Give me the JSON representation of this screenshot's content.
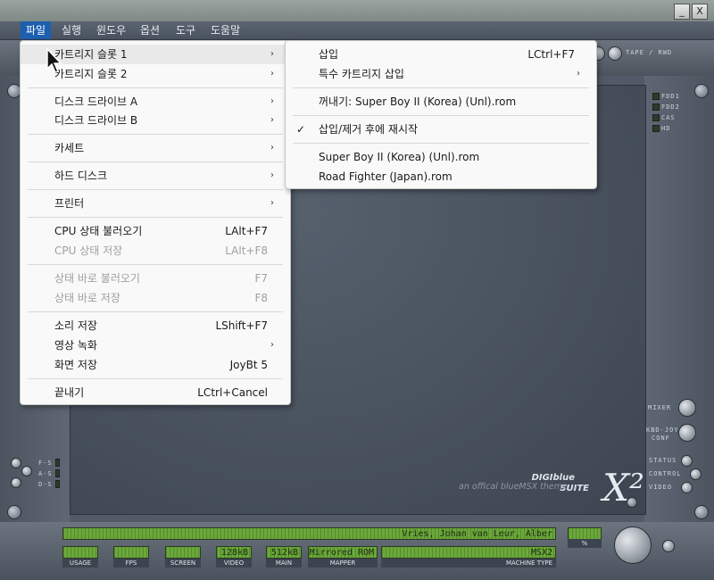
{
  "window": {
    "minimize_label": "_",
    "close_label": "X"
  },
  "menubar": {
    "items": [
      "파일",
      "실행",
      "윈도우",
      "옵션",
      "도구",
      "도움말"
    ]
  },
  "toolbar": {
    "tape_label": "TAPE / RWD"
  },
  "file_menu": {
    "items": [
      {
        "label": "카트리지 슬롯 1",
        "shortcut": "",
        "submenu": true,
        "enabled": true
      },
      {
        "label": "카트리지 슬롯 2",
        "shortcut": "",
        "submenu": true,
        "enabled": true
      },
      {
        "label": "디스크 드라이브 A",
        "shortcut": "",
        "submenu": true,
        "enabled": true
      },
      {
        "label": "디스크 드라이브 B",
        "shortcut": "",
        "submenu": true,
        "enabled": true
      },
      {
        "label": "카세트",
        "shortcut": "",
        "submenu": true,
        "enabled": true
      },
      {
        "label": "하드 디스크",
        "shortcut": "",
        "submenu": true,
        "enabled": true
      },
      {
        "label": "프린터",
        "shortcut": "",
        "submenu": true,
        "enabled": true
      },
      {
        "label": "CPU 상태 불러오기",
        "shortcut": "LAlt+F7",
        "submenu": false,
        "enabled": true
      },
      {
        "label": "CPU 상태 저장",
        "shortcut": "LAlt+F8",
        "submenu": false,
        "enabled": false
      },
      {
        "label": "상태 바로 불러오기",
        "shortcut": "F7",
        "submenu": false,
        "enabled": false
      },
      {
        "label": "상태 바로 저장",
        "shortcut": "F8",
        "submenu": false,
        "enabled": false
      },
      {
        "label": "소리 저장",
        "shortcut": "LShift+F7",
        "submenu": false,
        "enabled": true
      },
      {
        "label": "영상 녹화",
        "shortcut": "",
        "submenu": true,
        "enabled": true
      },
      {
        "label": "화면 저장",
        "shortcut": "JoyBt 5",
        "submenu": false,
        "enabled": true
      },
      {
        "label": "끝내기",
        "shortcut": "LCtrl+Cancel",
        "submenu": false,
        "enabled": true
      }
    ]
  },
  "cartridge_menu": {
    "items": [
      {
        "label": "삽입",
        "shortcut": "LCtrl+F7",
        "submenu": false,
        "checked": false
      },
      {
        "label": "특수 카트리지 삽입",
        "shortcut": "",
        "submenu": true,
        "checked": false
      },
      {
        "label": "꺼내기: Super Boy II (Korea) (Unl).rom",
        "shortcut": "",
        "submenu": false,
        "checked": false
      },
      {
        "label": "삽입/제거 후에 재시작",
        "shortcut": "",
        "submenu": false,
        "checked": true
      },
      {
        "label": "Super Boy II (Korea) (Unl).rom",
        "shortcut": "",
        "submenu": false,
        "checked": false
      },
      {
        "label": "Road Fighter (Japan).rom",
        "shortcut": "",
        "submenu": false,
        "checked": false
      }
    ],
    "check_mark": "✓"
  },
  "leds_right": [
    "FDD1",
    "FDD2",
    "CAS",
    "HD"
  ],
  "leds_left": [
    "F-S",
    "A-S",
    "D-S"
  ],
  "controls_right": {
    "mixer": "MIXER",
    "kbd_joy": "KBD-JOY",
    "config": "CONF",
    "status": "STATUS",
    "control": "CONTROL",
    "video": "VIDEO"
  },
  "branding": {
    "digi": "DIGIblue",
    "suite": "SUITE",
    "tagline": "an offical blueMSX theme",
    "x2": "X²"
  },
  "status_bar": {
    "ticker": "Vries,  Johan van Leur,  Alber",
    "usage_label": "USAGE",
    "fps_label": "FPS",
    "screen_label": "SCREEN",
    "video_value": "128kB",
    "video_label": "VIDEO",
    "main_value": "512kB",
    "main_label": "MAIN",
    "mapper_value": "Mirrored ROM",
    "mapper_label": "MAPPER",
    "machine_value": "MSX2",
    "machine_label": "MACHINE TYPE",
    "volume_label": "%"
  }
}
